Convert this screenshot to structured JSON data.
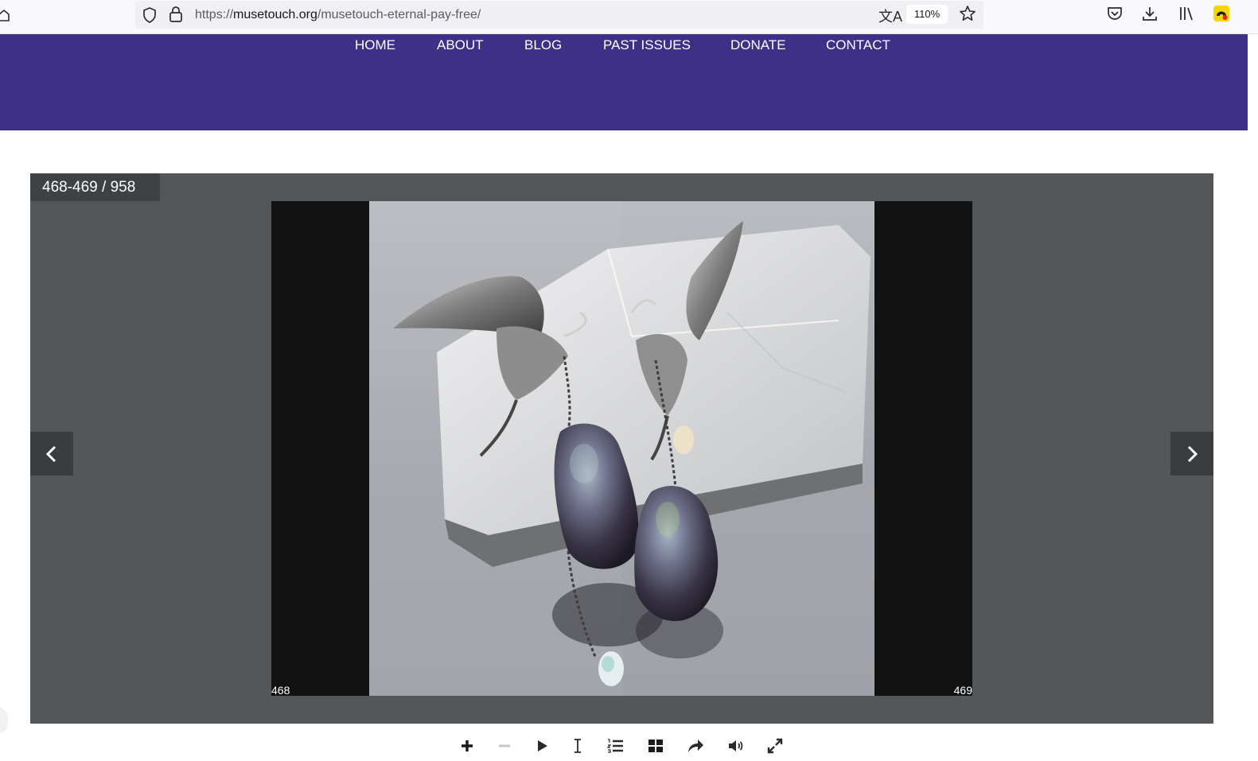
{
  "browser": {
    "url_scheme": "https://",
    "url_domain": "musetouch.org",
    "url_path": "/musetouch-eternal-pay-free/",
    "zoom": "110%",
    "icons": [
      "home-icon",
      "shield-icon",
      "lock-icon",
      "translate-icon",
      "bookmark-star-icon",
      "pocket-icon",
      "download-icon",
      "library-icon",
      "extension-icon"
    ]
  },
  "nav": {
    "items": [
      "HOME",
      "ABOUT",
      "BLOG",
      "PAST ISSUES",
      "DONATE",
      "CONTACT"
    ]
  },
  "viewer": {
    "page_counter": "468-469 / 958",
    "left_page_number": "468",
    "right_page_number": "469",
    "image_subject": "hummingbird earrings with baroque pearls on quartz crystal"
  },
  "toolbar": {
    "icons": [
      "zoom-in-icon",
      "zoom-out-icon",
      "play-icon",
      "text-select-icon",
      "table-of-contents-icon",
      "thumbnails-icon",
      "share-icon",
      "sound-icon",
      "fullscreen-icon"
    ]
  },
  "colors": {
    "nav_bg": "#3e3086",
    "viewer_bg": "#53575a",
    "spread_bg": "#121212"
  }
}
